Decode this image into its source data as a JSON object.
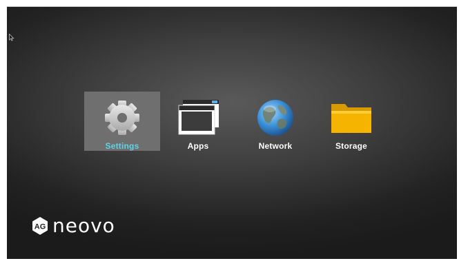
{
  "apps": [
    {
      "label": "Settings",
      "icon": "gear-icon",
      "selected": true
    },
    {
      "label": "Apps",
      "icon": "windows-stack-icon",
      "selected": false
    },
    {
      "label": "Network",
      "icon": "globe-icon",
      "selected": false
    },
    {
      "label": "Storage",
      "icon": "folder-icon",
      "selected": false
    }
  ],
  "brand": {
    "badge_text": "AG",
    "wordmark": "neovo"
  },
  "colors": {
    "selected_label": "#5fd3e6",
    "selected_tile": "#6f6f6f",
    "folder": "#f5b400",
    "globe_ocean": "#3a8fd6",
    "background": "#3a3a3a"
  }
}
